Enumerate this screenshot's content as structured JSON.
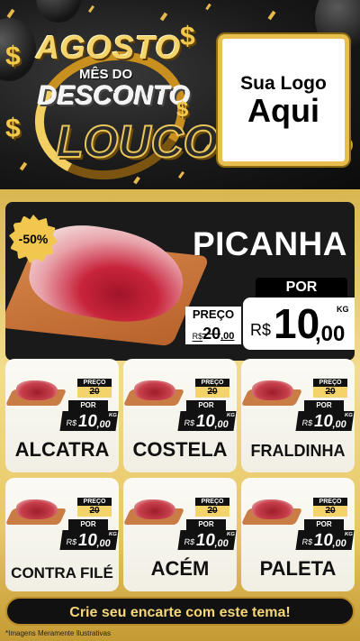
{
  "promo": {
    "line1": "AGOSTO",
    "line2": "MÊS DO",
    "line3": "DESCONTO",
    "line4": "LOUCO"
  },
  "logo": {
    "line1": "Sua Logo",
    "line2": "Aqui"
  },
  "featured": {
    "name": "PICANHA",
    "discount": "-50%",
    "preco_label": "PREÇO",
    "old_currency": "R$",
    "old_int": "20",
    "old_dec": ",00",
    "por_label": "POR",
    "currency": "R$",
    "price_int": "10",
    "price_dec": ",00",
    "unit": "KG"
  },
  "products": [
    {
      "name": "ALCATRA",
      "preco_label": "PREÇO",
      "old_price": "20",
      "por_label": "POR",
      "currency": "R$",
      "price_int": "10",
      "price_dec": ",00",
      "unit": "KG"
    },
    {
      "name": "COSTELA",
      "preco_label": "PREÇO",
      "old_price": "20",
      "por_label": "POR",
      "currency": "R$",
      "price_int": "10",
      "price_dec": ",00",
      "unit": "KG"
    },
    {
      "name": "FRALDINHA",
      "preco_label": "PREÇO",
      "old_price": "20",
      "por_label": "POR",
      "currency": "R$",
      "price_int": "10",
      "price_dec": ",00",
      "unit": "KG"
    },
    {
      "name": "CONTRA FILÉ",
      "preco_label": "PREÇO",
      "old_price": "20",
      "por_label": "POR",
      "currency": "R$",
      "price_int": "10",
      "price_dec": ",00",
      "unit": "KG"
    },
    {
      "name": "ACÉM",
      "preco_label": "PREÇO",
      "old_price": "20",
      "por_label": "POR",
      "currency": "R$",
      "price_int": "10",
      "price_dec": ",00",
      "unit": "KG"
    },
    {
      "name": "PALETA",
      "preco_label": "PREÇO",
      "old_price": "20",
      "por_label": "POR",
      "currency": "R$",
      "price_int": "10",
      "price_dec": ",00",
      "unit": "KG"
    }
  ],
  "cta": "Crie seu encarte com este tema!",
  "disclaimer": "*Imagens Meramente Ilustrativas",
  "colors": {
    "gold": "#e8c866",
    "dark": "#111111",
    "white": "#ffffff"
  },
  "icons": {
    "dollar": "$"
  }
}
